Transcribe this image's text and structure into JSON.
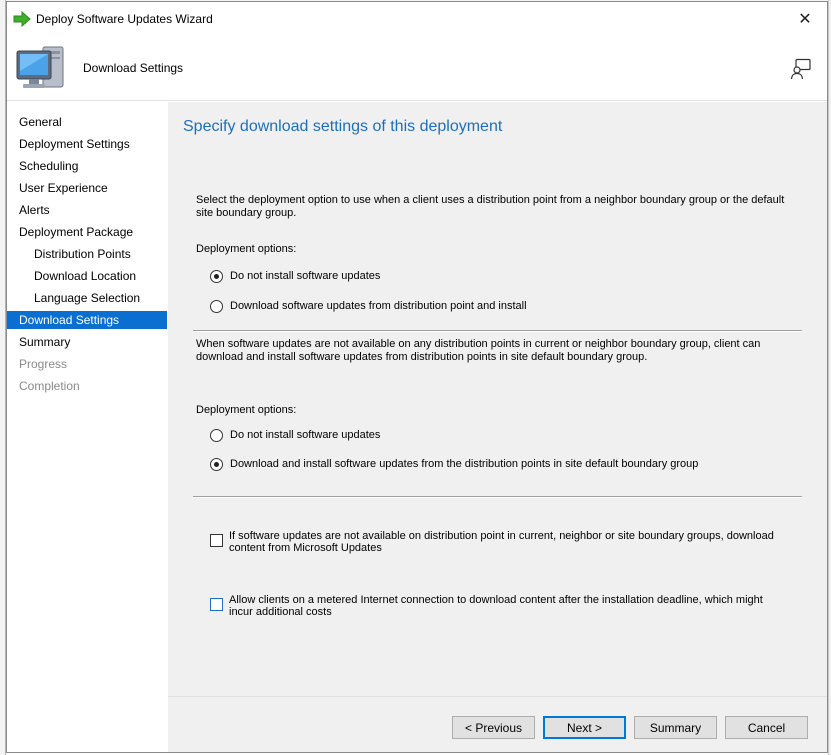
{
  "window": {
    "title": "Deploy Software Updates Wizard",
    "close_glyph": "✕"
  },
  "header": {
    "page_name": "Download Settings"
  },
  "icons": {
    "app": "green-arrow-icon",
    "header": "computer-monitor-icon",
    "help": "help-person-icon"
  },
  "nav": {
    "items": [
      {
        "label": "General",
        "state": "normal"
      },
      {
        "label": "Deployment Settings",
        "state": "normal"
      },
      {
        "label": "Scheduling",
        "state": "normal"
      },
      {
        "label": "User Experience",
        "state": "normal"
      },
      {
        "label": "Alerts",
        "state": "normal"
      },
      {
        "label": "Deployment Package",
        "state": "normal"
      },
      {
        "label": "Distribution Points",
        "state": "sub"
      },
      {
        "label": "Download Location",
        "state": "sub"
      },
      {
        "label": "Language Selection",
        "state": "sub"
      },
      {
        "label": "Download Settings",
        "state": "active"
      },
      {
        "label": "Summary",
        "state": "normal"
      },
      {
        "label": "Progress",
        "state": "disabled"
      },
      {
        "label": "Completion",
        "state": "disabled"
      }
    ]
  },
  "main": {
    "heading": "Specify download settings of this deployment",
    "section1": {
      "description": "Select the deployment option to use when a client uses a distribution point from a neighbor boundary group or the default site boundary group.",
      "options_label": "Deployment options:",
      "options": [
        {
          "label": "Do not install software updates",
          "checked": true
        },
        {
          "label": "Download software updates from distribution point and install",
          "checked": false
        }
      ]
    },
    "section2": {
      "description": "When software updates are not available on any distribution points in current or neighbor boundary group, client can download and install software updates from distribution points in site default boundary group.",
      "options_label": "Deployment options:",
      "options": [
        {
          "label": "Do not install software updates",
          "checked": false
        },
        {
          "label": "Download and install software updates from the distribution points in site default boundary group",
          "checked": true
        }
      ]
    },
    "checkboxes": [
      {
        "label": "If software updates are not available on distribution point in current, neighbor or site boundary groups, download content from Microsoft Updates",
        "checked": false
      },
      {
        "label": "Allow clients on a metered Internet connection to download content after the installation deadline, which might incur additional costs",
        "checked": false
      }
    ]
  },
  "footer": {
    "previous": "< Previous",
    "next": "Next >",
    "summary": "Summary",
    "cancel": "Cancel"
  },
  "colors": {
    "accent": "#0b6fd1",
    "heading": "#1d6fbe",
    "panel_bg": "#f0f0f0"
  }
}
